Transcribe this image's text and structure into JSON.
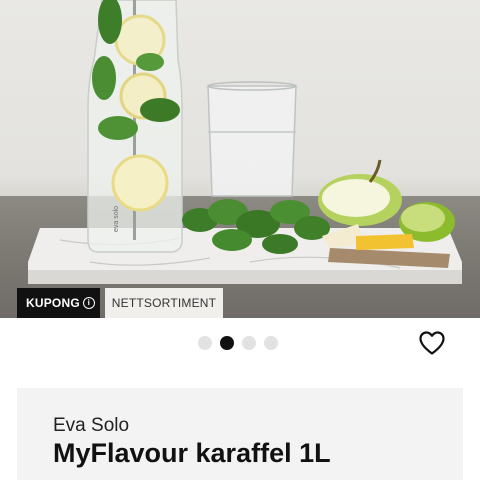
{
  "product_image": {
    "alt": "",
    "carafe_print": "eva solo"
  },
  "badges": {
    "coupon_label": "KUPONG",
    "coupon_info_glyph": "i",
    "online_label": "NETTSORTIMENT"
  },
  "carousel": {
    "count": 4,
    "active_index": 1
  },
  "product": {
    "brand": "Eva Solo",
    "title": "MyFlavour karaffel 1L"
  },
  "icons": {
    "favorite": "heart-outline-icon",
    "info": "info-circle-icon"
  },
  "colors": {
    "badge_dark": "#111111",
    "badge_light": "#f0efec",
    "card_bg": "#f3f3f3",
    "dot_active": "#111111",
    "dot_inactive": "#e2e2e2"
  }
}
